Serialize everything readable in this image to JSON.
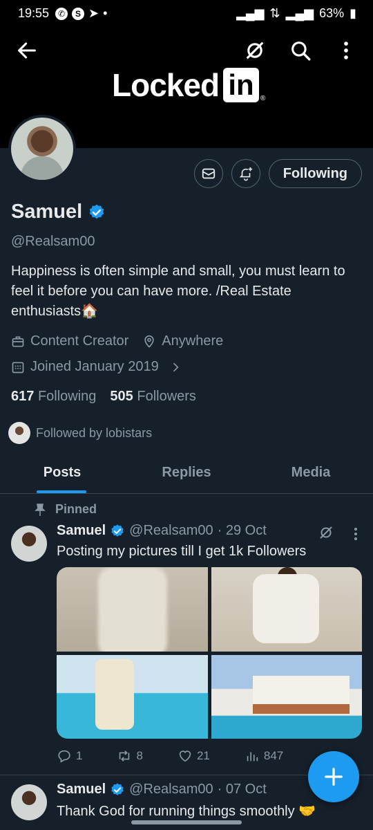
{
  "status_bar": {
    "time": "19:55",
    "battery": "63%"
  },
  "banner": {
    "logo_word": "Locked",
    "logo_box": "in",
    "logo_reg": "®"
  },
  "profile": {
    "follow_button": "Following",
    "name": "Samuel",
    "handle": "@Realsam00",
    "bio": "Happiness is often simple and small, you must learn to feel it before you can have more. /Real Estate enthusiasts🏠",
    "category": "Content Creator",
    "location": "Anywhere",
    "joined": "Joined January 2019",
    "following_count": "617",
    "following_label": "Following",
    "followers_count": "505",
    "followers_label": "Followers",
    "followed_by": "Followed by lobistars"
  },
  "tabs": [
    {
      "label": "Posts"
    },
    {
      "label": "Replies"
    },
    {
      "label": "Media"
    }
  ],
  "pinned_label": "Pinned",
  "posts": [
    {
      "name": "Samuel",
      "handle": "@Realsam00",
      "date": "· 29 Oct",
      "text": "Posting my pictures till I get 1k Followers",
      "replies": "1",
      "reposts": "8",
      "likes": "21",
      "views": "847"
    },
    {
      "name": "Samuel",
      "handle": "@Realsam00",
      "date": "· 07 Oct",
      "text": "Thank God for running things smoothly 🤝"
    }
  ],
  "colors": {
    "accent": "#1d9bf0",
    "background": "#15202b",
    "muted": "#8b98a5"
  }
}
